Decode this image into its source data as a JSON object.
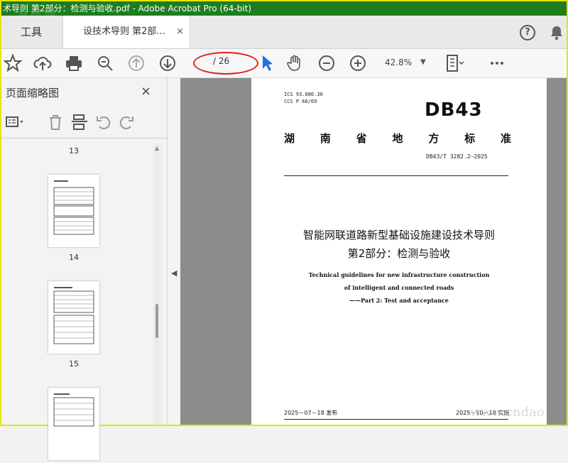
{
  "window": {
    "title": "术导则 第2部分：检测与验收.pdf - Adobe Acrobat Pro (64-bit)"
  },
  "tabs": {
    "tools_label": "工具",
    "doc_label": "设技术导则 第2部...",
    "close_glyph": "×"
  },
  "toolbar": {
    "page_total": "/ 26",
    "page_value": "",
    "zoom": "42.8%"
  },
  "left_panel": {
    "title": "页面缩略图",
    "close_glyph": "×",
    "page_numbers": [
      "13",
      "14",
      "15"
    ]
  },
  "document": {
    "ics": "ICS 93.080.30",
    "ccs": "CCS P 66/69",
    "standard_code": "DB43",
    "standard_type_chars": [
      "湖",
      "南",
      "省",
      "地",
      "方",
      "标",
      "准"
    ],
    "standard_number": "DB43/T 3282.2—2025",
    "title_cn_line1": "智能网联道路新型基础设施建设技术导则",
    "title_cn_line2": "第2部分：检测与验收",
    "title_en_line1": "Technical guidelines for new infrastructure construction",
    "title_en_line2": "of intelligent and connected roads",
    "title_en_line3": "——Part 2: Test and acceptance",
    "issue_date": "2025－07－18 发布",
    "implement_date": "2025－10－18 实施"
  },
  "watermarks": {
    "top_left": "道标网",
    "bottom_right": "www.cndao"
  },
  "colors": {
    "title_bar": "#1e7d1e",
    "accent_blue": "#2a6fdb",
    "annotation_red": "#e02020"
  }
}
